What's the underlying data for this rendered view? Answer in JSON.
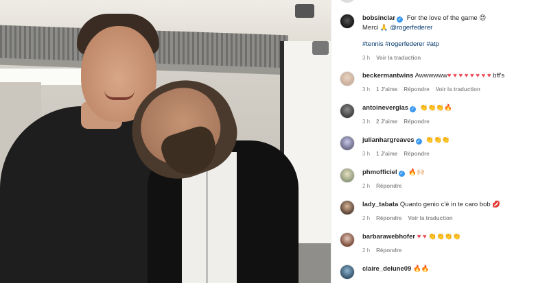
{
  "post": {
    "author": "bobsinclar",
    "caption": "For the love of the game",
    "caption_emoji": "😍",
    "line2_prefix": "Merci",
    "line2_emoji": "🙏",
    "mention": "@rogerfederer",
    "hashtags": "#tennis #rogerfederer #atp",
    "time": "3 h",
    "translate": "Voir la traduction"
  },
  "comments": [
    {
      "user": "beckermantwins",
      "verified": false,
      "text": "Awwwwww",
      "emoji": "♥ ♥ ♥ ♥ ♥ ♥ ♥ ♥",
      "tail": "bff's",
      "time": "3 h",
      "likes": "1 J'aime",
      "reply": "Répondre",
      "translate": "Voir la traduction"
    },
    {
      "user": "antoineverglas",
      "verified": true,
      "text": "",
      "emoji": "👏👏👏🔥",
      "tail": "",
      "time": "3 h",
      "likes": "2 J'aime",
      "reply": "Répondre",
      "translate": ""
    },
    {
      "user": "julianhargreaves",
      "verified": true,
      "text": "",
      "emoji": "👏👏👏",
      "tail": "",
      "time": "3 h",
      "likes": "1 J'aime",
      "reply": "Répondre",
      "translate": ""
    },
    {
      "user": "phmofficiel",
      "verified": true,
      "text": "",
      "emoji": "🔥🙌🏻",
      "tail": "",
      "time": "2 h",
      "likes": "",
      "reply": "Répondre",
      "translate": ""
    },
    {
      "user": "lady_tabata",
      "verified": false,
      "text": "Quanto genio c'è in te caro bob",
      "emoji": "💋",
      "tail": "",
      "time": "2 h",
      "likes": "",
      "reply": "Répondre",
      "translate": "Voir la traduction"
    },
    {
      "user": "barbarawebhofer",
      "verified": false,
      "text": "",
      "emoji": "♥ ♥ 👏👏👏👏",
      "tail": "",
      "time": "2 h",
      "likes": "",
      "reply": "Répondre",
      "translate": ""
    },
    {
      "user": "claire_delune09",
      "verified": false,
      "text": "",
      "emoji": "🔥🔥",
      "tail": "",
      "time": "",
      "likes": "",
      "reply": "",
      "translate": ""
    }
  ],
  "icons": {
    "verified": "✓",
    "heart": "♥"
  },
  "colors": {
    "link": "#00376b",
    "meta": "#8e8e8e",
    "verified": "#3897f0",
    "heart": "#ed4956"
  }
}
